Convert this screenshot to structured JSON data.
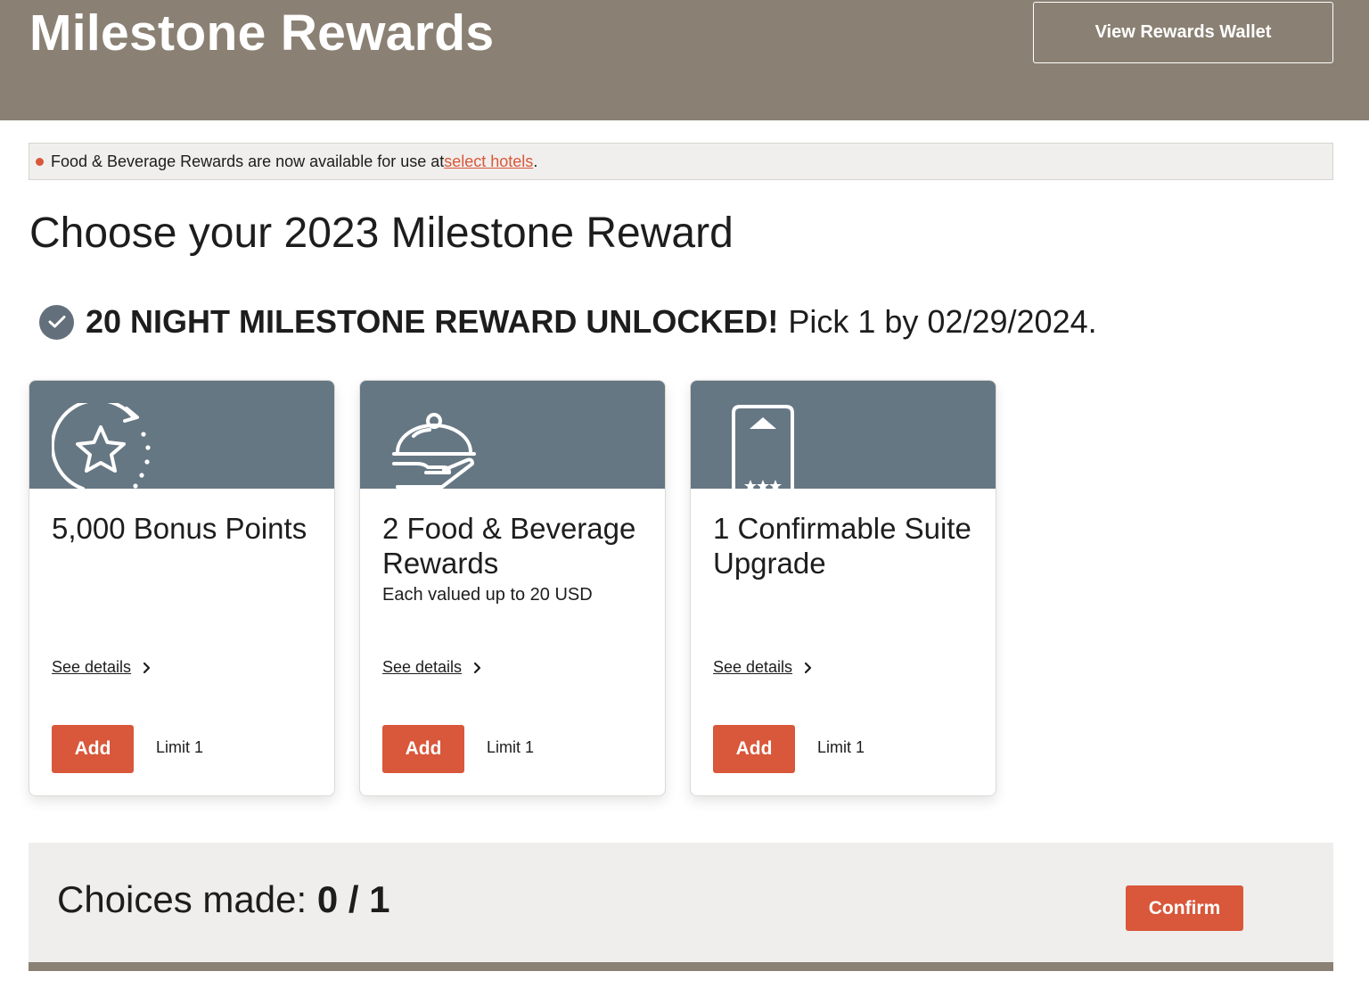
{
  "header": {
    "title": "Milestone Rewards",
    "wallet_button": "View Rewards Wallet"
  },
  "notice": {
    "text": "Food & Beverage Rewards are now available for use at ",
    "link": "select hotels",
    "suffix": "."
  },
  "headline": "Choose your 2023 Milestone Reward",
  "unlocked": {
    "bold": "20 NIGHT MILESTONE REWARD UNLOCKED!",
    "rest": "Pick 1 by 02/29/2024."
  },
  "cards": [
    {
      "icon": "star-refresh-icon",
      "title": "5,000 Bonus Points",
      "subtitle": "",
      "details": "See details",
      "add": "Add",
      "limit": "Limit 1"
    },
    {
      "icon": "cloche-icon",
      "title": "2 Food & Beverage Rewards",
      "subtitle": "Each valued up to 20 USD",
      "details": "See details",
      "add": "Add",
      "limit": "Limit 1"
    },
    {
      "icon": "suite-door-icon",
      "title": "1 Confirmable Suite Upgrade",
      "subtitle": "",
      "details": "See details",
      "add": "Add",
      "limit": "Limit 1"
    }
  ],
  "footer": {
    "choices_label": "Choices made: ",
    "choices_value": "0 / 1",
    "confirm": "Confirm"
  },
  "colors": {
    "header_bg": "#8a8174",
    "accent": "#d9573a",
    "banner": "#667784",
    "check": "#63707c"
  }
}
